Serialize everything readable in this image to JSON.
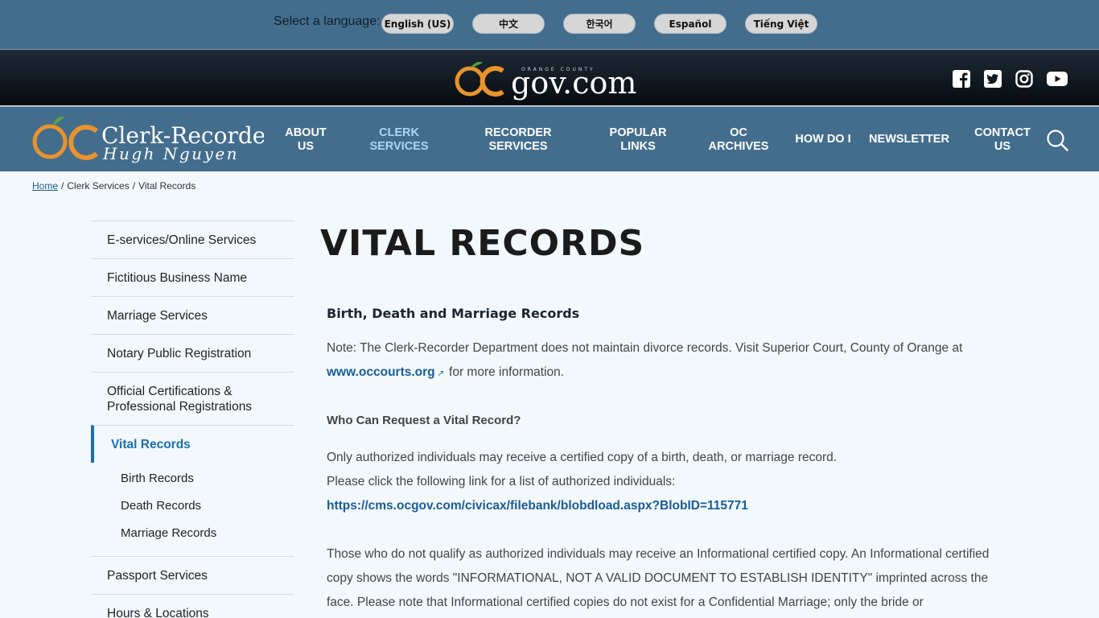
{
  "language_bar": {
    "label": "Select a language:",
    "languages": [
      "English (US)",
      "中文",
      "한국어",
      "Español",
      "Tiếng Việt"
    ]
  },
  "ocgov": {
    "logo_text": "gov.com",
    "logo_small": "ORANGE COUNTY",
    "social_icons": [
      "facebook-icon",
      "twitter-icon",
      "instagram-icon",
      "youtube-icon"
    ]
  },
  "site": {
    "logo_line1": "Clerk-Recorder",
    "logo_line2": "Hugh Nguyen"
  },
  "nav": {
    "items": [
      {
        "label": "ABOUT US"
      },
      {
        "label": "CLERK SERVICES",
        "active": true
      },
      {
        "label": "RECORDER SERVICES"
      },
      {
        "label": "POPULAR LINKS"
      },
      {
        "label": "OC ARCHIVES"
      },
      {
        "label": "HOW DO I"
      },
      {
        "label": "NEWSLETTER"
      },
      {
        "label": "CONTACT US"
      }
    ]
  },
  "breadcrumb": {
    "home": "Home",
    "level1": "Clerk Services",
    "current": "Vital Records"
  },
  "sidebar": {
    "items": [
      "E-services/Online Services",
      "Fictitious Business Name",
      "Marriage Services",
      "Notary Public Registration",
      "Official Certifications & Professional Registrations",
      "Vital Records",
      "Passport Services",
      "Hours & Locations"
    ],
    "sub_items": [
      "Birth Records",
      "Death Records",
      "Marriage Records"
    ]
  },
  "content": {
    "title": "VITAL RECORDS",
    "section_heading": "Birth, Death and Marriage Records",
    "note_text": " Note: The Clerk-Recorder Department does not maintain divorce records. Visit Superior Court, County of Orange at",
    "note_link": "www.occourts.org",
    "note_suffix": "for more information.",
    "who_heading": "Who Can Request a Vital Record?",
    "auth_line1": "Only authorized individuals may receive a certified copy of a birth, death, or marriage record.",
    "auth_line2": "Please click the following link for a list of authorized individuals:",
    "auth_link": "https://cms.ocgov.com/civicax/filebank/blobdload.aspx?BlobID=115771",
    "info_text": "Those who do not qualify as authorized individuals may receive an Informational certified copy. An Informational certified copy shows the words \"INFORMATIONAL, NOT A VALID DOCUMENT TO ESTABLISH IDENTITY\" imprinted across the face. Please note that Informational certified copies do not exist for a Confidential Marriage; only the bride or"
  }
}
